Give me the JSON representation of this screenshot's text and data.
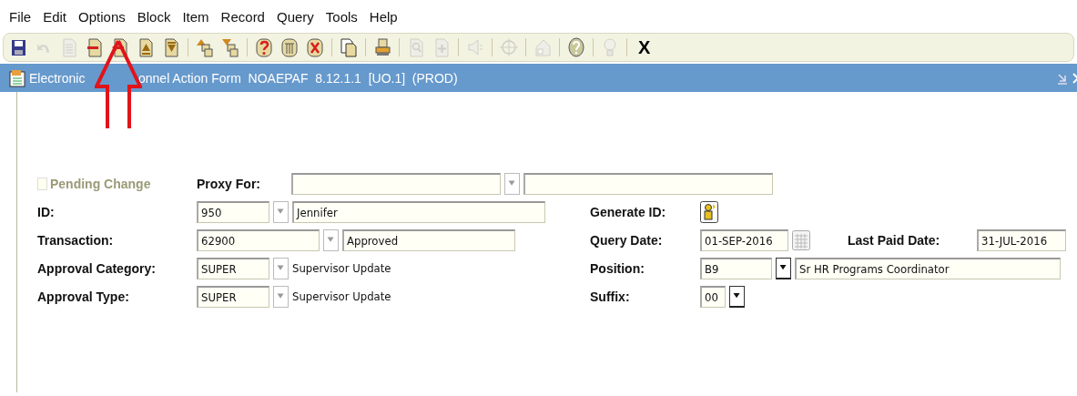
{
  "menu": [
    {
      "label": "File"
    },
    {
      "label": "Edit"
    },
    {
      "label": "Options"
    },
    {
      "label": "Block"
    },
    {
      "label": "Item"
    },
    {
      "label": "Record"
    },
    {
      "label": "Query"
    },
    {
      "label": "Tools"
    },
    {
      "label": "Help"
    }
  ],
  "toolbar": {
    "groups": [
      [
        {
          "kind": "save",
          "disabled": false
        },
        {
          "kind": "rollback",
          "disabled": true
        },
        {
          "kind": "page",
          "disabled": true
        },
        {
          "kind": "doc-minus",
          "disabled": false
        },
        {
          "kind": "doc-arrow",
          "disabled": false
        },
        {
          "kind": "doc-up",
          "disabled": false
        },
        {
          "kind": "doc-down",
          "disabled": false
        }
      ],
      [
        {
          "kind": "stack-up",
          "disabled": false
        },
        {
          "kind": "stack-down",
          "disabled": false
        }
      ],
      [
        {
          "kind": "drum-question",
          "disabled": false
        },
        {
          "kind": "drum",
          "disabled": false
        },
        {
          "kind": "drum-x",
          "disabled": false
        }
      ],
      [
        {
          "kind": "documents",
          "disabled": false
        }
      ],
      [
        {
          "kind": "printer",
          "disabled": false
        }
      ],
      [
        {
          "kind": "magnifier",
          "disabled": true
        },
        {
          "kind": "doc-plus",
          "disabled": true
        }
      ],
      [
        {
          "kind": "speaker",
          "disabled": true
        }
      ],
      [
        {
          "kind": "crosshair",
          "disabled": true
        }
      ],
      [
        {
          "kind": "house",
          "disabled": true
        }
      ],
      [
        {
          "kind": "help",
          "disabled": false
        }
      ],
      [
        {
          "kind": "lightbulb",
          "disabled": true
        }
      ]
    ],
    "close_label": "X"
  },
  "window": {
    "title_parts": [
      "Electronic",
      "onnel Action Form  NOAEPAF  8.12.1.1  [UO.1]  (PROD)"
    ]
  },
  "form": {
    "pending_change": {
      "label": "Pending Change",
      "checked": false,
      "disabled": true
    },
    "proxy_for": {
      "label": "Proxy For:",
      "lookup_disabled": true
    },
    "left_rows": [
      {
        "label": "ID:",
        "code": "950",
        "lookup_disabled": true,
        "description": "Jennifer",
        "kind": "field"
      },
      {
        "label": "Transaction:",
        "code": "62900",
        "lookup_disabled": true,
        "description": "Approved",
        "kind": "field"
      },
      {
        "label": "Approval Category:",
        "code": "SUPER",
        "lookup_disabled": true,
        "description": "Supervisor Update",
        "kind": "text"
      },
      {
        "label": "Approval Type:",
        "code": "SUPER",
        "lookup_disabled": true,
        "description": "Supervisor Update",
        "kind": "text"
      }
    ],
    "right_rows": [
      {
        "kind": "button",
        "label": "Generate ID:"
      },
      {
        "kind": "date",
        "label": "Query Date:",
        "value": "01-SEP-2016",
        "extra_label": "Last Paid Date:",
        "extra_value": "31-JUL-2016"
      },
      {
        "kind": "lookup",
        "label": "Position:",
        "value": "B9",
        "lookup_disabled": false,
        "description": "Sr HR Programs Coordinator"
      },
      {
        "kind": "lookup",
        "label": "Suffix:",
        "value": "00",
        "lookup_disabled": false
      }
    ]
  }
}
